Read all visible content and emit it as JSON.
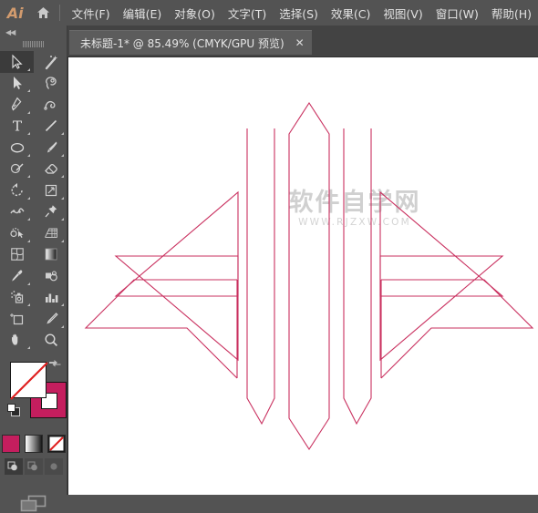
{
  "app": {
    "name": "Ai",
    "logo_color": "#d29b6e",
    "home_icon": "home-icon"
  },
  "menubar": {
    "items": [
      {
        "label": "文件(F)",
        "name": "menu-file"
      },
      {
        "label": "编辑(E)",
        "name": "menu-edit"
      },
      {
        "label": "对象(O)",
        "name": "menu-object"
      },
      {
        "label": "文字(T)",
        "name": "menu-type"
      },
      {
        "label": "选择(S)",
        "name": "menu-select"
      },
      {
        "label": "效果(C)",
        "name": "menu-effect"
      },
      {
        "label": "视图(V)",
        "name": "menu-view"
      },
      {
        "label": "窗口(W)",
        "name": "menu-window"
      },
      {
        "label": "帮助(H)",
        "name": "menu-help"
      }
    ]
  },
  "tabbar": {
    "document": {
      "title": "未标题-1* @ 85.49% (CMYK/GPU 预览)",
      "filename": "未标题-1*",
      "zoom": "85.49%",
      "color_mode": "CMYK",
      "preview_mode": "GPU 预览",
      "modified": true,
      "close_label": "✕"
    }
  },
  "toolpanel": {
    "collapse_label": "◀◀",
    "tools": [
      {
        "name": "selection-tool",
        "icon": "arrow-cursor-icon",
        "active": true,
        "has_flyout": true
      },
      {
        "name": "magic-wand-tool",
        "icon": "magic-wand-icon",
        "active": false,
        "has_flyout": false
      },
      {
        "name": "direct-selection-tool",
        "icon": "direct-arrow-icon",
        "active": false,
        "has_flyout": true
      },
      {
        "name": "lasso-tool",
        "icon": "lasso-icon",
        "active": false,
        "has_flyout": false
      },
      {
        "name": "pen-tool",
        "icon": "pen-icon",
        "active": false,
        "has_flyout": true
      },
      {
        "name": "curvature-tool",
        "icon": "curvature-icon",
        "active": false,
        "has_flyout": false
      },
      {
        "name": "type-tool",
        "icon": "type-T-icon",
        "active": false,
        "has_flyout": true
      },
      {
        "name": "line-segment-tool",
        "icon": "line-segment-icon",
        "active": false,
        "has_flyout": true
      },
      {
        "name": "ellipse-tool",
        "icon": "ellipse-icon",
        "active": false,
        "has_flyout": true
      },
      {
        "name": "paintbrush-tool",
        "icon": "paintbrush-icon",
        "active": false,
        "has_flyout": true
      },
      {
        "name": "shaper-tool",
        "icon": "shaper-pencil-icon",
        "active": false,
        "has_flyout": true
      },
      {
        "name": "eraser-tool",
        "icon": "eraser-icon",
        "active": false,
        "has_flyout": true
      },
      {
        "name": "rotate-tool",
        "icon": "rotate-icon",
        "active": false,
        "has_flyout": true
      },
      {
        "name": "scale-tool",
        "icon": "scale-icon",
        "active": false,
        "has_flyout": true
      },
      {
        "name": "width-tool",
        "icon": "width-warp-icon",
        "active": false,
        "has_flyout": true
      },
      {
        "name": "free-transform-tool",
        "icon": "pushpin-icon",
        "active": false,
        "has_flyout": true
      },
      {
        "name": "shape-builder-tool",
        "icon": "shape-builder-icon",
        "active": false,
        "has_flyout": true
      },
      {
        "name": "perspective-grid-tool",
        "icon": "perspective-grid-icon",
        "active": false,
        "has_flyout": true
      },
      {
        "name": "mesh-tool",
        "icon": "mesh-icon",
        "active": false,
        "has_flyout": false
      },
      {
        "name": "gradient-tool",
        "icon": "gradient-icon",
        "active": false,
        "has_flyout": false
      },
      {
        "name": "eyedropper-tool",
        "icon": "eyedropper-icon",
        "active": false,
        "has_flyout": true
      },
      {
        "name": "blend-tool",
        "icon": "blend-icon",
        "active": false,
        "has_flyout": false
      },
      {
        "name": "symbol-sprayer-tool",
        "icon": "symbol-sprayer-icon",
        "active": false,
        "has_flyout": true
      },
      {
        "name": "column-graph-tool",
        "icon": "bar-chart-icon",
        "active": false,
        "has_flyout": true
      },
      {
        "name": "artboard-tool",
        "icon": "artboard-icon",
        "active": false,
        "has_flyout": false
      },
      {
        "name": "slice-tool",
        "icon": "slice-knife-icon",
        "active": false,
        "has_flyout": true
      },
      {
        "name": "hand-tool",
        "icon": "hand-icon",
        "active": false,
        "has_flyout": true
      },
      {
        "name": "zoom-tool",
        "icon": "magnifier-icon",
        "active": false,
        "has_flyout": false
      }
    ],
    "color_controls": {
      "fill_color": "#ffffff",
      "fill_is_none": true,
      "stroke_color": "#c41e5e",
      "swap_icon": "swap-fill-stroke-icon",
      "default_icon": "default-fill-stroke-icon",
      "buttons": [
        {
          "name": "color-swatch-button",
          "icon": "solid-color-icon",
          "active": true
        },
        {
          "name": "gradient-swatch-button",
          "icon": "gradient-icon",
          "active": false
        },
        {
          "name": "none-swatch-button",
          "icon": "none-slash-icon",
          "active": false
        }
      ],
      "draw_modes": [
        {
          "name": "draw-normal-button",
          "icon": "draw-normal-icon",
          "active": true
        },
        {
          "name": "draw-behind-button",
          "icon": "draw-behind-icon",
          "active": false
        },
        {
          "name": "draw-inside-button",
          "icon": "draw-inside-icon",
          "active": false
        }
      ],
      "screen_mode": {
        "name": "change-screen-mode-button",
        "icon": "screen-mode-icon"
      }
    }
  },
  "canvas": {
    "background": "#ffffff",
    "artwork": {
      "name": "diamond-arrow-vector-artwork",
      "stroke_color": "#c9305f",
      "stroke_width": 1,
      "fill": "none",
      "description": "Symmetric diamond composed of mirrored chevron arrows"
    },
    "watermark": {
      "main_text": "软件自学网",
      "sub_text": "WWW.RJZXW.COM",
      "color": "#969696"
    }
  }
}
